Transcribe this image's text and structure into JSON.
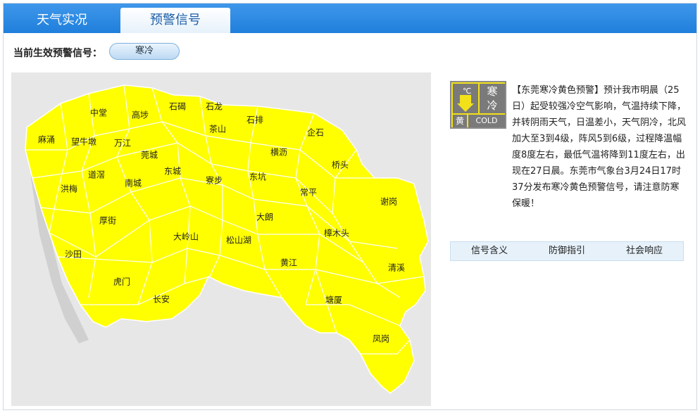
{
  "tabs": {
    "live": "天气实况",
    "warning": "预警信号"
  },
  "current": {
    "label": "当前生效预警信号：",
    "signal": "寒冷"
  },
  "colors": {
    "tab_bar": "#1f7fdc",
    "map_fill": "#ffff00",
    "map_background": "#e7e7e7",
    "warning_yellow": "#f2e11a"
  },
  "map": {
    "towns": [
      "中堂",
      "高埗",
      "石碣",
      "石龙",
      "石排",
      "麻涌",
      "望牛墩",
      "万江",
      "茶山",
      "企石",
      "莞城",
      "横沥",
      "道滘",
      "东城",
      "洪梅",
      "南城",
      "寮步",
      "东坑",
      "桥头",
      "常平",
      "谢岗",
      "厚街",
      "大朗",
      "大岭山",
      "松山湖",
      "沙田",
      "樟木头",
      "黄江",
      "清溪",
      "虎门",
      "长安",
      "塘厦",
      "凤岗"
    ]
  },
  "warning_icon": {
    "therm": "℃",
    "han": "寒\n冷",
    "yellow": "黄",
    "cold": "COLD",
    "icon": "cold-warning-icon"
  },
  "description": "【东莞寒冷黄色预警】预计我市明晨（25日）起受较强冷空气影响，气温持续下降，并转阴雨天气，日温差小，天气阴冷，北风加大至3到4级，阵风5到6级，过程降温幅度8度左右，最低气温将降到11度左右，出现在27日晨。东莞市气象台3月24日17时37分发布寒冷黄色预警信号，请注意防寒保暖！",
  "subtabs": [
    "信号含义",
    "防御指引",
    "社会响应"
  ]
}
